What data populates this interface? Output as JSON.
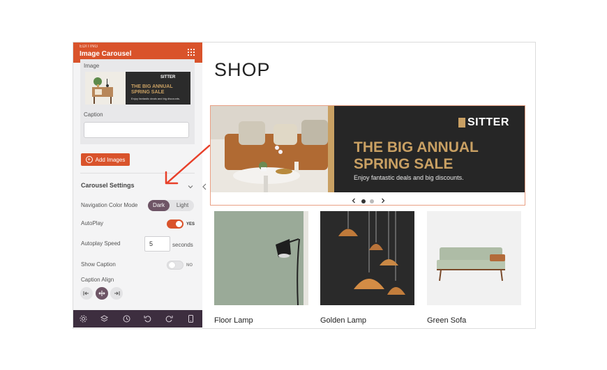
{
  "sidebar": {
    "editing_label": "EDITING",
    "title": "Image Carousel",
    "image_label": "Image",
    "thumb": {
      "brand": "SITTER",
      "line1": "THE BIG ANNUAL",
      "line2": "SPRING SALE",
      "line3": "Enjoy fantastic deals and big discounts."
    },
    "caption_label": "Caption",
    "caption_value": "",
    "add_images_label": "Add Images",
    "carousel_settings_title": "Carousel Settings",
    "nav_color_mode_label": "Navigation Color Mode",
    "nav_color_options": [
      "Dark",
      "Light"
    ],
    "nav_color_selected": "Dark",
    "autoplay_label": "AutoPlay",
    "autoplay_state": "YES",
    "autoplay_speed_label": "Autoplay Speed",
    "autoplay_speed_value": "5",
    "autoplay_speed_unit": "seconds",
    "show_caption_label": "Show Caption",
    "show_caption_state": "NO",
    "caption_align_label": "Caption Align",
    "caption_align_options": [
      "align-left-icon",
      "align-center-icon",
      "align-right-icon"
    ],
    "caption_align_selected": "center",
    "footer_icons": [
      "gear-icon",
      "layers-icon",
      "history-icon",
      "undo-icon",
      "redo-icon",
      "mobile-preview-icon"
    ]
  },
  "main": {
    "page_title": "SHOP",
    "carousel": {
      "brand": "SITTER",
      "headline_line1": "THE BIG ANNUAL",
      "headline_line2": "SPRING SALE",
      "subtext": "Enjoy fantastic deals and big discounts.",
      "slide_count": 2,
      "active_slide": 1
    },
    "products": [
      {
        "name": "Floor Lamp"
      },
      {
        "name": "Golden Lamp"
      },
      {
        "name": "Green Sofa"
      }
    ]
  },
  "colors": {
    "accent": "#d9532b",
    "footer_bg": "#3d2e3f",
    "selected": "#6e5566",
    "gold": "#c9a063",
    "annotation_arrow": "#e8402a"
  }
}
